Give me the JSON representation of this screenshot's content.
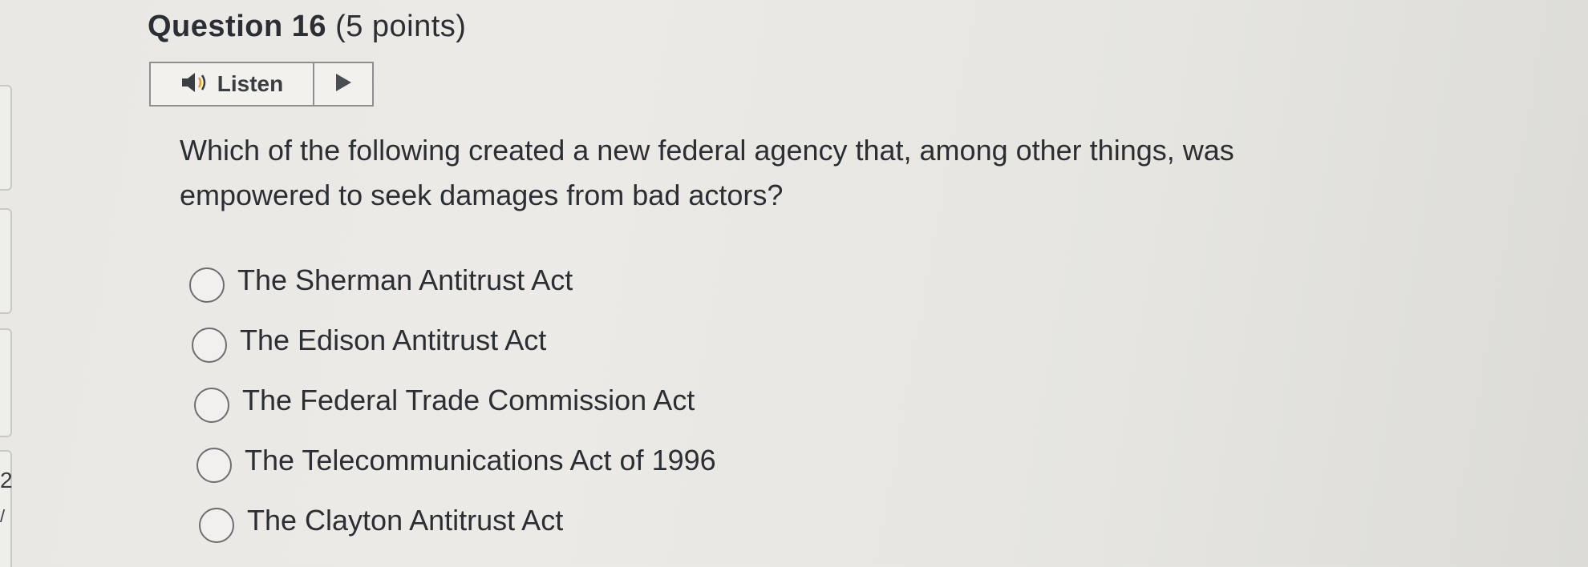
{
  "question": {
    "title": "Question 16",
    "points": "(5 points)",
    "text": "Which of the following created a new federal agency that, among other things, was empowered to seek damages from bad actors?"
  },
  "listen": {
    "label": "Listen",
    "speaker_icon": "speaker-icon",
    "play_icon": "play-icon"
  },
  "options": [
    {
      "label": "The Sherman Antitrust Act",
      "selected": false
    },
    {
      "label": "The Edison Antitrust Act",
      "selected": false
    },
    {
      "label": "The Federal Trade Commission Act",
      "selected": false
    },
    {
      "label": "The Telecommunications Act of 1996",
      "selected": false
    },
    {
      "label": "The Clayton Antitrust Act",
      "selected": false
    }
  ],
  "navigator": {
    "visible_number": "2",
    "visible_mark": "/"
  },
  "colors": {
    "background": "#e9e8e4",
    "text": "#2b2e33",
    "border": "#8e8f92"
  }
}
